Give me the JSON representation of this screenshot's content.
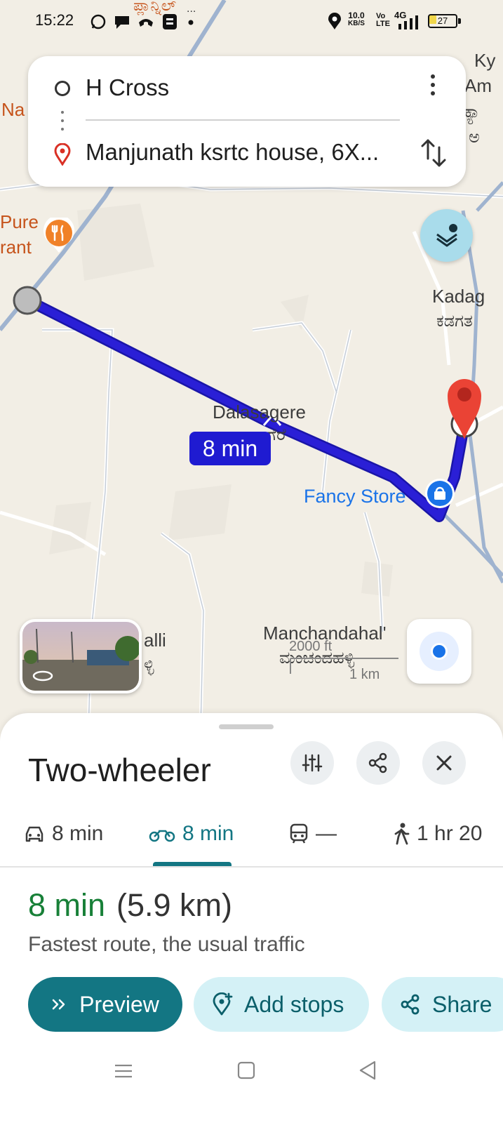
{
  "status_bar": {
    "time": "15:22",
    "net_speed_value": "10.0",
    "net_speed_unit": "KB/S",
    "volte_top": "Vo",
    "volte_bottom": "LTE",
    "network": "4G",
    "battery": "27",
    "kannada_fragment": "ಪ್ಲಾನ್ನಿಲ್",
    "ellipsis": "..."
  },
  "directions": {
    "origin": "H Cross",
    "destination": "Manjunath ksrtc house, 6X..."
  },
  "map": {
    "labels": {
      "ky": "Ky",
      "am": "Am",
      "kn1": "ಕ್ಯಾ",
      "kn2": "ಅ",
      "na": "Na",
      "pure": "Pure",
      "rant": "rant",
      "kadag": "Kadag",
      "kadag_kn": "ಕಡಗತ",
      "dalasagere": "Dalasagere",
      "dalasagere_kn": "ಗೆರೆ",
      "fancy_store": "Fancy Store",
      "alli": "alli",
      "alli_kn": "ಳ್ಳಿ",
      "manchandahalli": "Manchandahal'",
      "manchandahalli_kn": "ಮಂಚಂದಹಳ್ಳಿ"
    },
    "route_time": "8 min",
    "scale_ft": "2000 ft",
    "scale_km": "1 km",
    "route_color": "#2a1fd6"
  },
  "sheet": {
    "title": "Two-wheeler",
    "tabs": [
      {
        "label": "8 min",
        "icon": "car-icon"
      },
      {
        "label": "8 min",
        "icon": "motorcycle-icon"
      },
      {
        "label": "—",
        "icon": "transit-icon"
      },
      {
        "label": "1 hr 20",
        "icon": "walk-icon"
      }
    ],
    "duration": "8 min",
    "distance": "(5.9 km)",
    "description": "Fastest route, the usual traffic",
    "buttons": {
      "preview": "Preview",
      "add_stops": "Add stops",
      "share": "Share"
    },
    "colors": {
      "accent": "#137683",
      "duration_green": "#188038"
    }
  }
}
